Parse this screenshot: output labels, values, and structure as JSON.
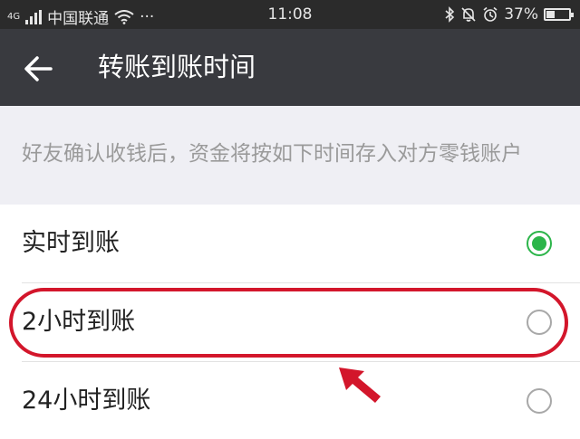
{
  "status_bar": {
    "network_badge": "4G",
    "carrier": "中国联通",
    "dots": "···",
    "time": "11:08",
    "battery_percent": "37%",
    "battery_level": 0.37,
    "icons": [
      "signal-icon",
      "wifi-icon",
      "bluetooth-icon",
      "mute-bell-icon",
      "alarm-icon",
      "battery-icon"
    ]
  },
  "nav": {
    "title": "转账到账时间",
    "back_icon": "back-arrow-icon"
  },
  "description": "好友确认收钱后，资金将按如下时间存入对方零钱账户",
  "options": [
    {
      "label": "实时到账",
      "selected": true
    },
    {
      "label": "2小时到账",
      "selected": false,
      "highlighted": true
    },
    {
      "label": "24小时到账",
      "selected": false
    }
  ],
  "colors": {
    "nav_bg": "#393a3f",
    "status_bg": "#2b2b2b",
    "accent_green": "#2cb54a",
    "highlight_red": "#d3162b",
    "page_bg": "#efeff4"
  }
}
